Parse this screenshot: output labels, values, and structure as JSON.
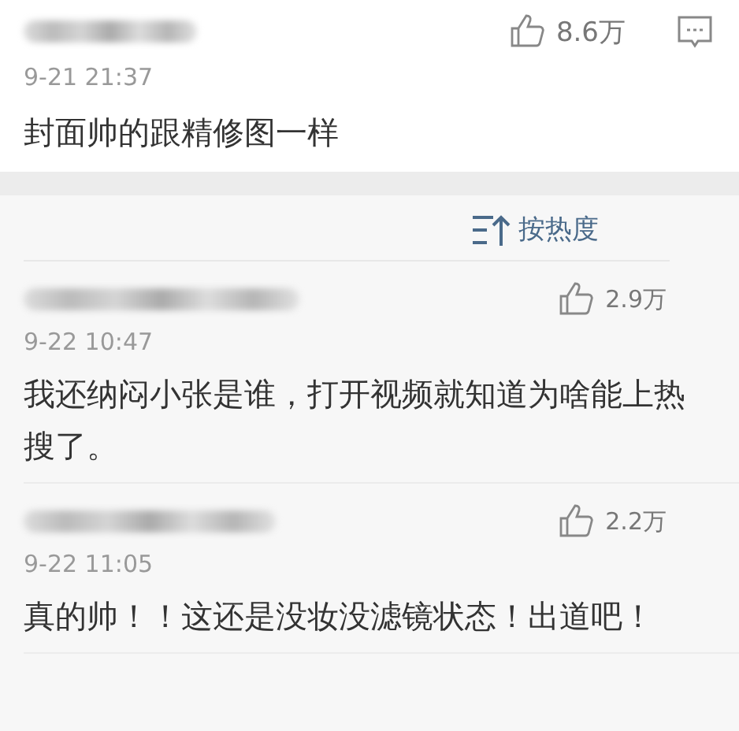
{
  "top_comment": {
    "likes": "8.6万",
    "time": "9-21 21:37",
    "text": "封面帅的跟精修图一样"
  },
  "sort": {
    "label": "按热度"
  },
  "comments": [
    {
      "likes": "2.9万",
      "time": "9-22 10:47",
      "text": "我还纳闷小张是谁，打开视频就知道为啥能上热搜了。"
    },
    {
      "likes": "2.2万",
      "time": "9-22 11:05",
      "text": "真的帅！！这还是没妆没滤镜状态！出道吧！"
    }
  ]
}
